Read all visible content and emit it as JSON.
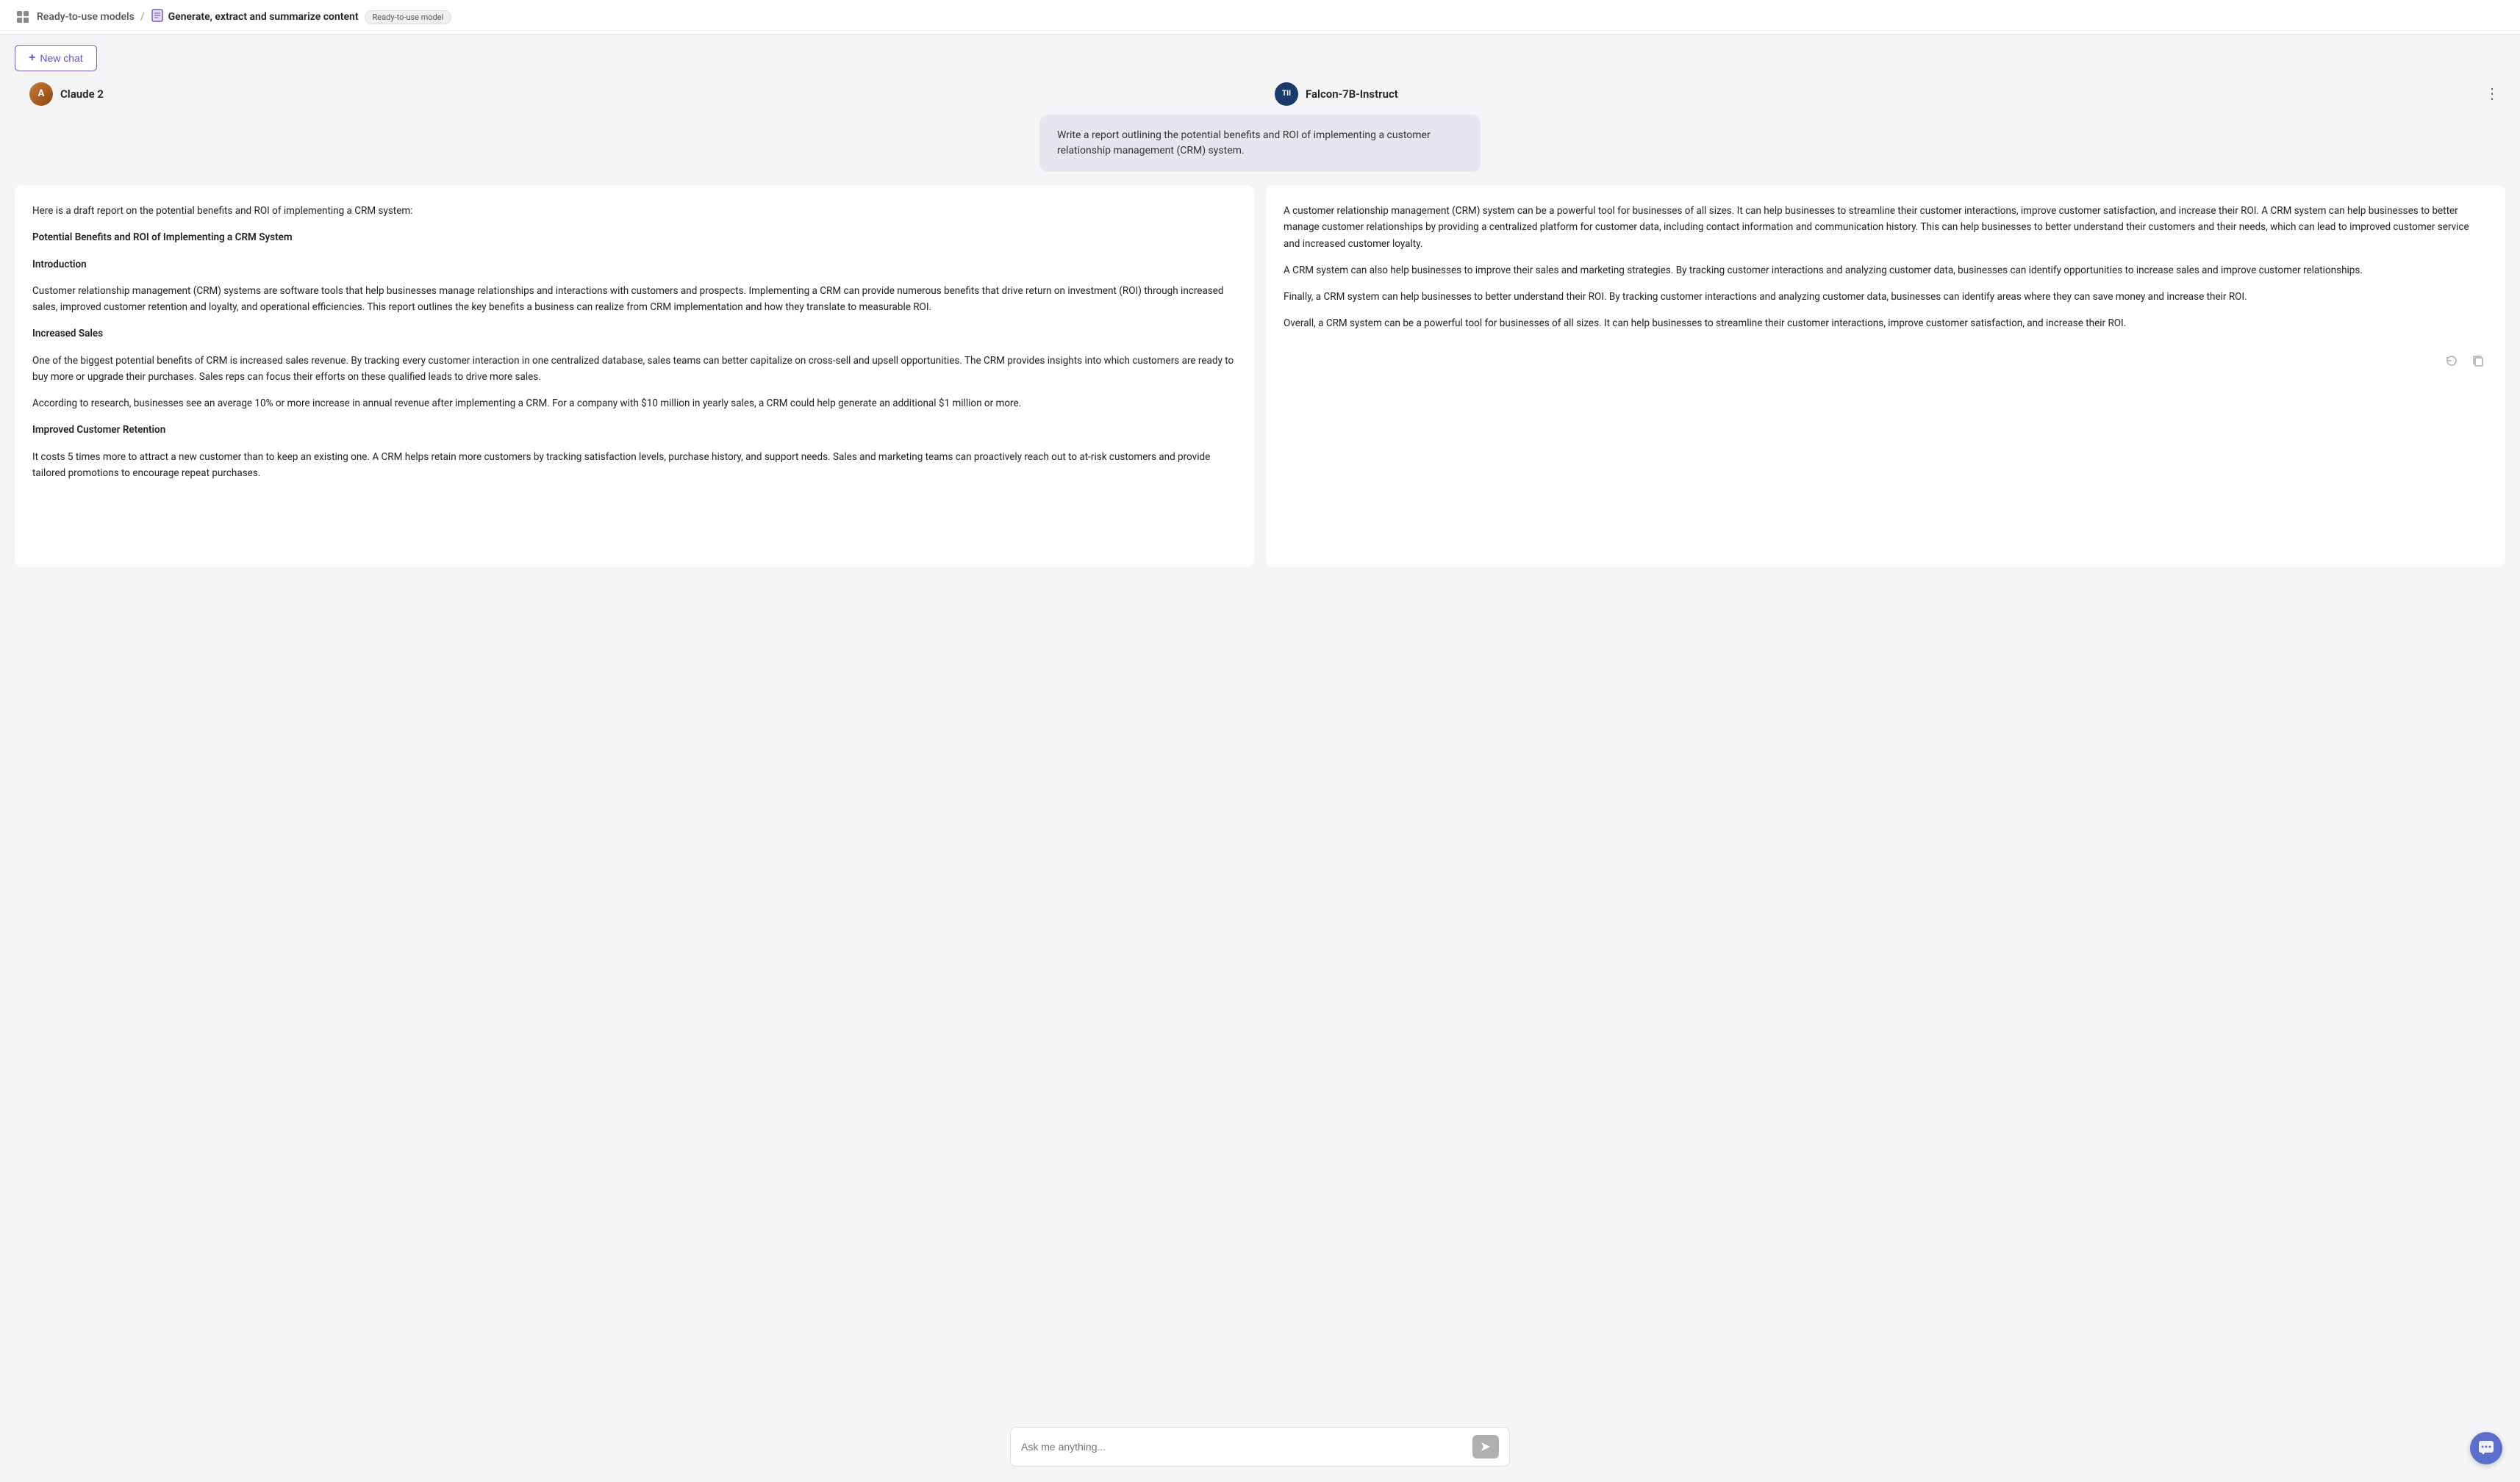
{
  "header": {
    "breadcrumb_part1": "Ready-to-use models",
    "separator": "/",
    "breadcrumb_part2": "Generate, extract and summarize content",
    "badge_label": "Ready-to-use model",
    "icon1_label": "grid-icon",
    "icon2_label": "document-icon"
  },
  "toolbar": {
    "new_chat_label": "New chat"
  },
  "models": {
    "left": {
      "name": "Claude 2",
      "avatar_text": "A"
    },
    "right": {
      "name": "Falcon-7B-Instruct",
      "avatar_text": "TII"
    }
  },
  "prompt": {
    "text": "Write a report outlining the potential benefits and ROI of implementing a customer relationship management (CRM) system."
  },
  "responses": {
    "left": {
      "paragraphs": [
        "Here is a draft report on the potential benefits and ROI of implementing a CRM system:",
        "Potential Benefits and ROI of Implementing a CRM System",
        "Introduction",
        "Customer relationship management (CRM) systems are software tools that help businesses manage relationships and interactions with customers and prospects. Implementing a CRM can provide numerous benefits that drive return on investment (ROI) through increased sales, improved customer retention and loyalty, and operational efficiencies. This report outlines the key benefits a business can realize from CRM implementation and how they translate to measurable ROI.",
        "Increased Sales",
        "One of the biggest potential benefits of CRM is increased sales revenue. By tracking every customer interaction in one centralized database, sales teams can better capitalize on cross-sell and upsell opportunities. The CRM provides insights into which customers are ready to buy more or upgrade their purchases. Sales reps can focus their efforts on these qualified leads to drive more sales.",
        "According to research, businesses see an average 10% or more increase in annual revenue after implementing a CRM. For a company with $10 million in yearly sales, a CRM could help generate an additional $1 million or more.",
        "Improved Customer Retention",
        "It costs 5 times more to attract a new customer than to keep an existing one. A CRM helps retain more customers by tracking satisfaction levels, purchase history, and support needs. Sales and marketing teams can proactively reach out to at-risk customers and provide tailored promotions to encourage repeat purchases."
      ]
    },
    "right": {
      "paragraphs": [
        "A customer relationship management (CRM) system can be a powerful tool for businesses of all sizes. It can help businesses to streamline their customer interactions, improve customer satisfaction, and increase their ROI. A CRM system can help businesses to better manage customer relationships by providing a centralized platform for customer data, including contact information and communication history. This can help businesses to better understand their customers and their needs, which can lead to improved customer service and increased customer loyalty.",
        "A CRM system can also help businesses to improve their sales and marketing strategies. By tracking customer interactions and analyzing customer data, businesses can identify opportunities to increase sales and improve customer relationships.",
        "Finally, a CRM system can help businesses to better understand their ROI. By tracking customer interactions and analyzing customer data, businesses can identify areas where they can save money and increase their ROI.",
        "Overall, a CRM system can be a powerful tool for businesses of all sizes. It can help businesses to streamline their customer interactions, improve customer satisfaction, and increase their ROI."
      ]
    }
  },
  "input": {
    "placeholder": "Ask me anything...",
    "send_icon": "➤"
  },
  "fab": {
    "icon": "💬"
  }
}
